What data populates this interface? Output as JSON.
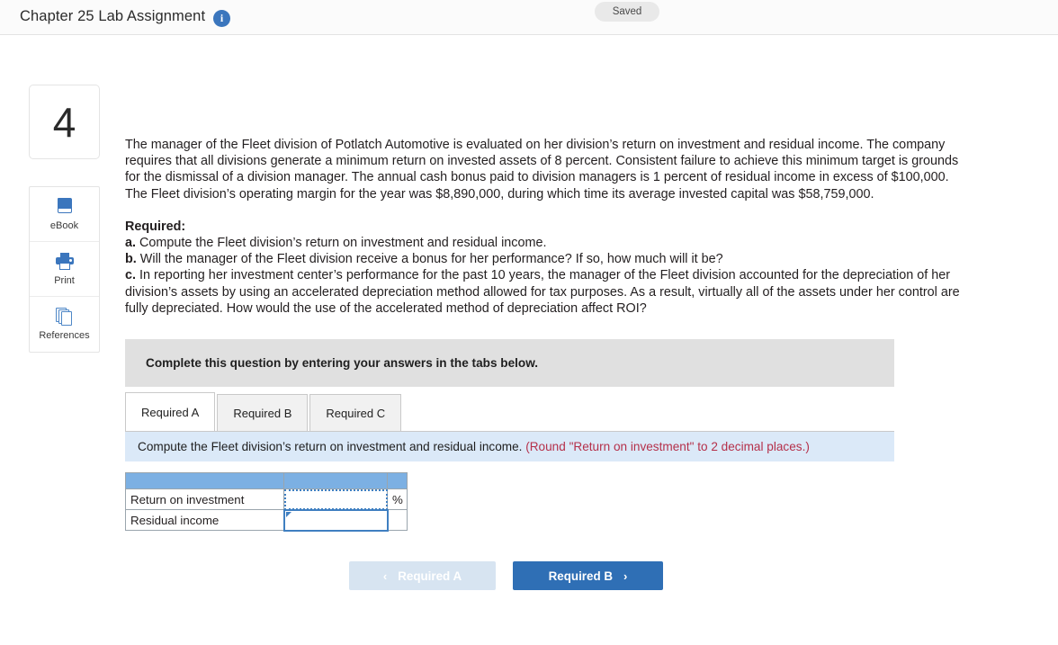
{
  "header": {
    "title": "Chapter 25 Lab Assignment",
    "info_icon": "info-icon",
    "saved_label": "Saved"
  },
  "rail": {
    "question_number": "4",
    "tools": [
      {
        "label": "eBook",
        "icon": "book-icon"
      },
      {
        "label": "Print",
        "icon": "printer-icon"
      },
      {
        "label": "References",
        "icon": "pages-icon"
      }
    ]
  },
  "question": {
    "prompt": "The manager of the Fleet division of Potlatch Automotive is evaluated on her division’s return on investment and residual income. The company requires that all divisions generate a minimum return on invested assets of 8 percent. Consistent failure to achieve this minimum target is grounds for the dismissal of a division manager. The annual cash bonus paid to division managers is 1 percent of residual income in excess of $100,000. The Fleet division’s operating margin for the year was $8,890,000, during which time its average invested capital was $58,759,000.",
    "required_heading": "Required:",
    "items": [
      {
        "marker": "a.",
        "text": "Compute the Fleet division’s return on investment and residual income."
      },
      {
        "marker": "b.",
        "text": "Will the manager of the Fleet division receive a bonus for her performance? If so, how much will it be?"
      },
      {
        "marker": "c.",
        "text": "In reporting her investment center’s performance for the past 10 years, the manager of the Fleet division accounted for the depreciation of her division’s assets by using an accelerated depreciation method allowed for tax purposes. As a result, virtually all of the assets under her control are fully depreciated. How would the use of the accelerated method of depreciation affect ROI?"
      }
    ]
  },
  "instruction_banner": "Complete this question by entering your answers in the tabs below.",
  "tabs": [
    {
      "label": "Required A",
      "active": true
    },
    {
      "label": "Required B",
      "active": false
    },
    {
      "label": "Required C",
      "active": false
    }
  ],
  "tab_panel": {
    "instruction": "Compute the Fleet division’s return on investment and residual income.",
    "round_note": "(Round \"Return on investment\" to 2 decimal places.)"
  },
  "answer_table": {
    "header_row": [
      "",
      "",
      ""
    ],
    "rows": [
      {
        "label": "Return on investment",
        "value": "",
        "unit": "%",
        "state": "dotted"
      },
      {
        "label": "Residual income",
        "value": "",
        "unit": "",
        "state": "selected"
      }
    ]
  },
  "navigation": {
    "prev_label": "Required A",
    "prev_chevron": "‹",
    "next_label": "Required B",
    "next_chevron": "›"
  },
  "colors": {
    "brand_blue": "#2f6fb5",
    "table_header_blue": "#7cb0e3",
    "panel_blue": "#dbe9f8",
    "gray_banner": "#e0e0e0",
    "note_red": "#b5304a",
    "icon_blue": "#3b76bd"
  }
}
